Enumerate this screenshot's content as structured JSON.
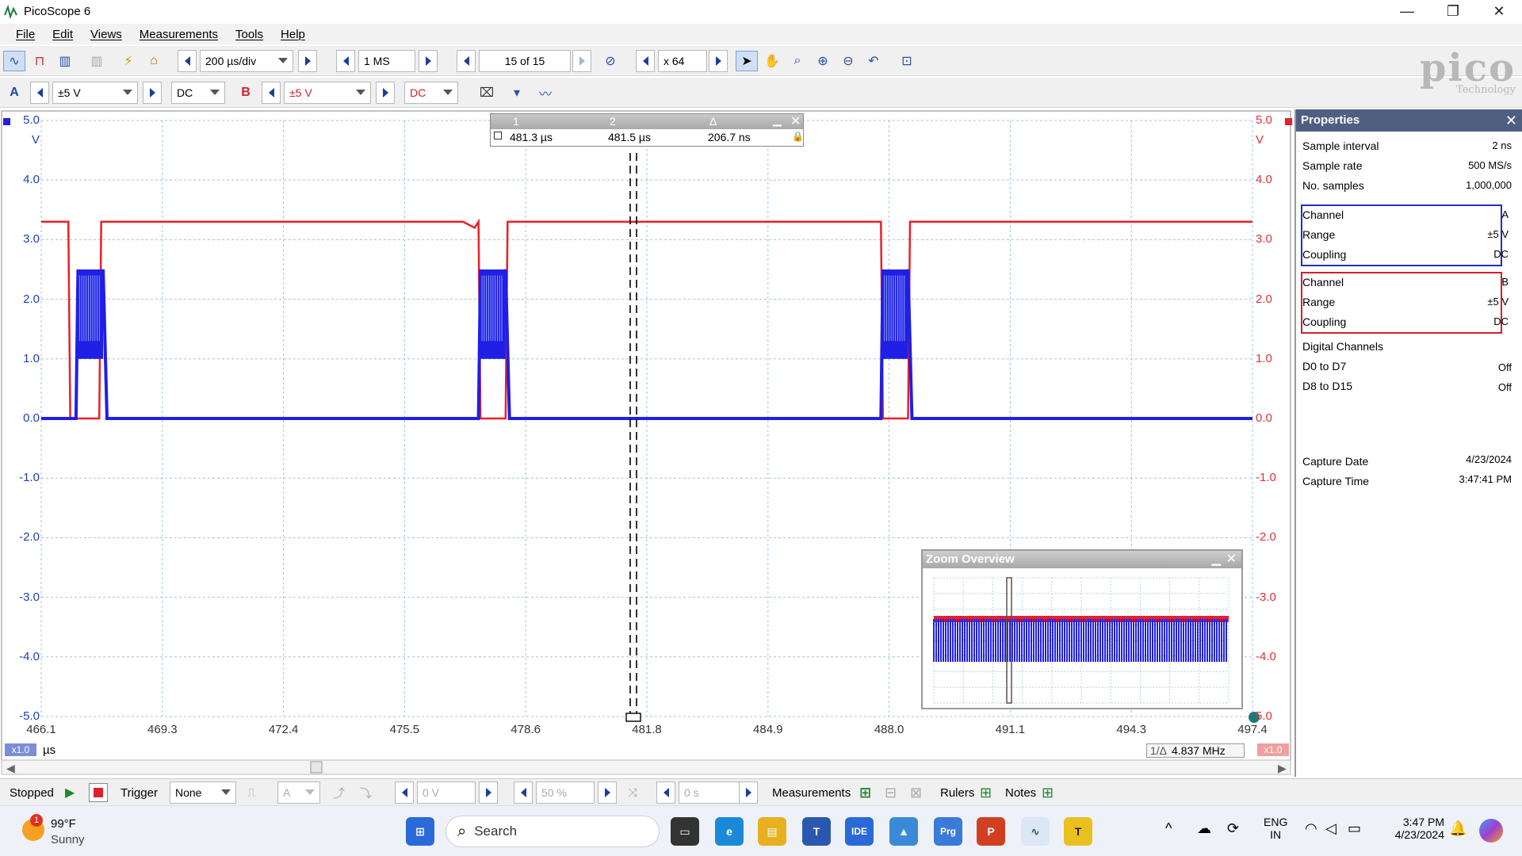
{
  "window": {
    "title": "PicoScope 6",
    "minimize": "—",
    "restore": "❐",
    "close": "✕"
  },
  "menu": [
    "File",
    "Edit",
    "Views",
    "Measurements",
    "Tools",
    "Help"
  ],
  "toolbar1": {
    "timebase": "200 µs/div",
    "samples": "1 MS",
    "buffer": "15 of 15",
    "zoom": "x 64"
  },
  "toolbar2": {
    "channel_a": {
      "label": "A",
      "range": "±5 V",
      "coupling": "DC"
    },
    "channel_b": {
      "label": "B",
      "range": "±5 V",
      "coupling": "DC"
    }
  },
  "logo": {
    "brand": "pico",
    "sub": "Technology"
  },
  "axes": {
    "y_left_unit": "V",
    "y_right_unit": "V",
    "y_ticks_left": [
      "5.0",
      "4.0",
      "3.0",
      "2.0",
      "1.0",
      "0.0",
      "-1.0",
      "-2.0",
      "-3.0",
      "-4.0",
      "-5.0"
    ],
    "y_ticks_right": [
      "5.0",
      "4.0",
      "3.0",
      "2.0",
      "1.0",
      "0.0",
      "-1.0",
      "-2.0",
      "-3.0",
      "-4.0",
      "5.0"
    ],
    "x_ticks": [
      "466.1",
      "469.3",
      "472.4",
      "475.5",
      "478.6",
      "481.8",
      "484.9",
      "488.0",
      "491.1",
      "494.3",
      "497.4"
    ],
    "x_unit": "µs",
    "x_scale": "x1.0",
    "right_scale": "x1.0",
    "freq_readout": "4.837 MHz",
    "freq_label": "1/Δ"
  },
  "rulers": {
    "col1": "1",
    "col2": "2",
    "col3": "Δ",
    "val1": "481.3 µs",
    "val2": "481.5 µs",
    "delta": "206.7 ns"
  },
  "zoom_overview": {
    "title": "Zoom Overview"
  },
  "chart_data": {
    "type": "line",
    "title": "",
    "xlabel": "µs",
    "ylabel": "V",
    "xlim": [
      466.1,
      497.4
    ],
    "ylim": [
      -5.0,
      5.0
    ],
    "grid": true,
    "series": [
      {
        "name": "A",
        "color": "#1f1fe6",
        "x": [
          466.1,
          467.0,
          467.05,
          467.15,
          467.7,
          467.8,
          468.0,
          477.4,
          477.45,
          477.55,
          478.1,
          478.2,
          478.4,
          487.8,
          487.85,
          487.95,
          488.5,
          488.6,
          488.8,
          497.4
        ],
        "y": [
          0.0,
          0.0,
          2.5,
          1.2,
          2.5,
          0.0,
          0.0,
          0.0,
          2.5,
          1.2,
          2.5,
          0.0,
          0.0,
          0.0,
          2.5,
          1.2,
          2.5,
          0.0,
          0.0,
          0.0
        ]
      },
      {
        "name": "B",
        "color": "#e8202a",
        "x": [
          466.1,
          466.8,
          466.85,
          467.6,
          467.65,
          468.0,
          477.0,
          477.3,
          477.4,
          477.45,
          478.1,
          478.15,
          487.8,
          487.85,
          488.5,
          488.55,
          497.4
        ],
        "y": [
          3.3,
          3.3,
          0.0,
          0.0,
          3.3,
          3.3,
          3.3,
          3.2,
          3.3,
          0.0,
          0.0,
          3.3,
          3.3,
          0.0,
          0.0,
          3.3,
          3.3
        ]
      }
    ]
  },
  "properties": {
    "title": "Properties",
    "sample_interval": {
      "label": "Sample interval",
      "value": "2 ns"
    },
    "sample_rate": {
      "label": "Sample rate",
      "value": "500 MS/s"
    },
    "num_samples": {
      "label": "No. samples",
      "value": "1,000,000"
    },
    "ch_a": {
      "channel_label": "Channel",
      "channel": "A",
      "range_label": "Range",
      "range": "±5 V",
      "coupling_label": "Coupling",
      "coupling": "DC",
      "color": "#2030c0"
    },
    "ch_b": {
      "channel_label": "Channel",
      "channel": "B",
      "range_label": "Range",
      "range": "±5 V",
      "coupling_label": "Coupling",
      "coupling": "DC",
      "color": "#d02030"
    },
    "digital_channels": "Digital Channels",
    "d0_d7": {
      "label": "D0 to D7",
      "value": "Off"
    },
    "d8_d15": {
      "label": "D8 to D15",
      "value": "Off"
    },
    "capture_date": {
      "label": "Capture Date",
      "value": "4/23/2024"
    },
    "capture_time": {
      "label": "Capture Time",
      "value": "3:47:41 PM"
    }
  },
  "statusbar": {
    "state": "Stopped",
    "trigger_label": "Trigger",
    "trigger_mode": "None",
    "trigger_source": "A",
    "trigger_level": "0 V",
    "pretrigger": "50 %",
    "delay": "0 s",
    "measurements": "Measurements",
    "rulers": "Rulers",
    "notes": "Notes"
  },
  "taskbar": {
    "weather_temp": "99°F",
    "weather_desc": "Sunny",
    "weather_badge": "1",
    "search": "Search",
    "lang1": "ENG",
    "lang2": "IN",
    "time": "3:47 PM",
    "date": "4/23/2024"
  }
}
